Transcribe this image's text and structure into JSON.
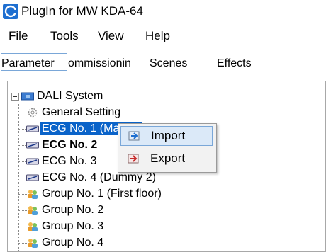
{
  "window": {
    "title": "PlugIn for MW KDA-64"
  },
  "menu": [
    "File",
    "Tools",
    "View",
    "Help"
  ],
  "tabs": [
    {
      "label": "Parameter",
      "active": true
    },
    {
      "label": "ommissionin",
      "active": false
    },
    {
      "label": "Scenes",
      "active": false
    },
    {
      "label": "Effects",
      "active": false
    }
  ],
  "tree": {
    "root": "DALI System",
    "items": [
      {
        "label": "General Setting",
        "icon": "gear-icon"
      },
      {
        "label": "ECG No. 1 (Mastitr)",
        "icon": "ecg-icon",
        "selected": true
      },
      {
        "label": "ECG No. 2",
        "icon": "ecg-icon",
        "bold": true
      },
      {
        "label": "ECG No. 3",
        "icon": "ecg-icon"
      },
      {
        "label": "ECG No. 4 (Dummy 2)",
        "icon": "ecg-icon"
      },
      {
        "label": "Group No. 1 (First floor)",
        "icon": "group-icon"
      },
      {
        "label": "Group No. 2",
        "icon": "group-icon"
      },
      {
        "label": "Group No. 3",
        "icon": "group-icon"
      },
      {
        "label": "Group No. 4",
        "icon": "group-icon"
      }
    ]
  },
  "context_menu": {
    "items": [
      {
        "label": "Import",
        "icon": "import-icon",
        "highlighted": true
      },
      {
        "label": "Export",
        "icon": "export-icon"
      }
    ]
  },
  "colors": {
    "selection": "#0a63c9",
    "accent": "#7aa7d8"
  }
}
